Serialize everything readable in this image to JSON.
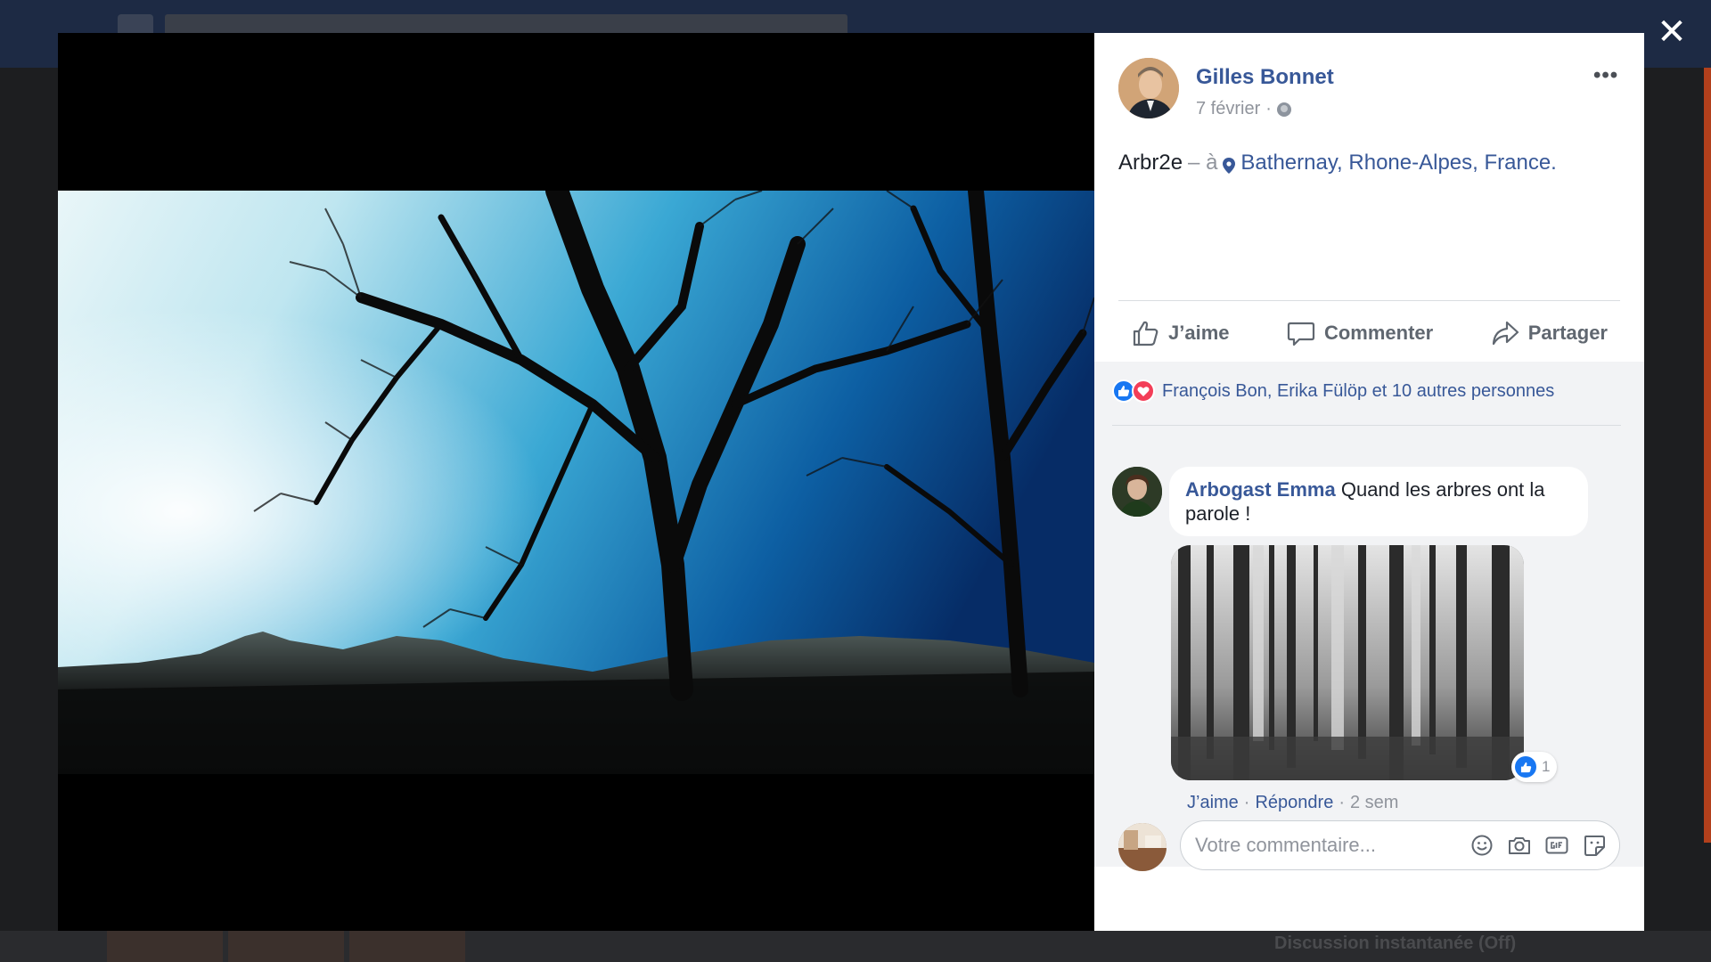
{
  "modal": {
    "close_label": "✕"
  },
  "post": {
    "author": "Gilles Bonnet",
    "date": "7 février",
    "date_separator": "·",
    "title": "Arbr2e",
    "location_prefix": "– à",
    "location": "Bathernay, Rhone-Alpes, France",
    "location_suffix": "."
  },
  "actions": {
    "like_label": "J’aime",
    "comment_label": "Commenter",
    "share_label": "Partager"
  },
  "reactions": {
    "text": "François Bon, Erika Fülöp et 10 autres personnes",
    "types": [
      "like",
      "love"
    ]
  },
  "comment": {
    "author": "Arbogast Emma",
    "text": "Quand les arbres ont la parole !",
    "likes": "1",
    "like_label": "J’aime",
    "reply_label": "Répondre",
    "age": "2 sem",
    "separator": "·"
  },
  "composer": {
    "placeholder": "Votre commentaire...",
    "icons": [
      "smile-icon",
      "camera-icon",
      "gif-icon",
      "sticker-icon"
    ]
  },
  "background": {
    "chat_label": "Discussion instantanée (Off)"
  },
  "colors": {
    "link": "#385898",
    "like_blue": "#1877f2",
    "love_red": "#f33e58"
  }
}
